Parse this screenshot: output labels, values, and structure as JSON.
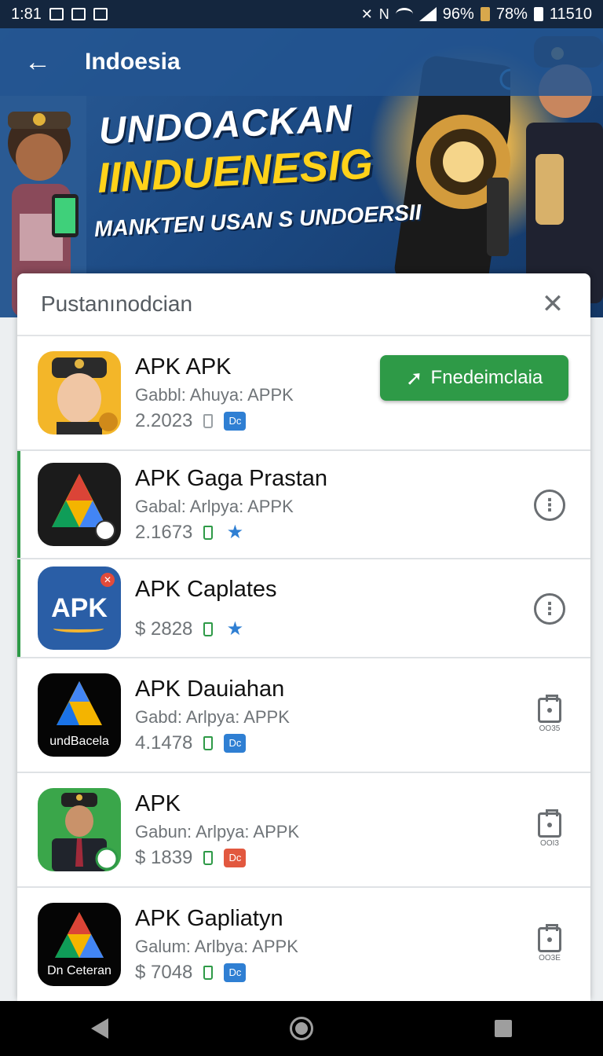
{
  "status_bar": {
    "time": "1:81",
    "signal_pct": "96%",
    "battery_pct": "78%",
    "right_value": "11510"
  },
  "app_bar": {
    "title": "Indoesia"
  },
  "hero": {
    "line1": "UNDOACKAN",
    "line2": "IINDUENESIG",
    "line3": "MANKTEN USAN S UNDOERSII"
  },
  "sheet": {
    "title": "Pustanınodcian",
    "close_glyph": "✕",
    "rows": [
      {
        "title": "APK APK",
        "subtitle": "Gabbl: Ahuya: APPK",
        "meta": "2.2023",
        "action": "Fnedeimclaia"
      },
      {
        "title": "APK Gaga Prastan",
        "subtitle": "Gabal: Arlpya: APPK",
        "meta": "2.1673"
      },
      {
        "title": "APK Caplates",
        "subtitle": "",
        "meta": "$ 2828",
        "icon_text": "APK"
      },
      {
        "title": "APK Dauiahan",
        "subtitle": "Gabd: Arlpya: APPK",
        "meta": "4.1478",
        "icon_caption": "undBacela",
        "clip_label": "OO35"
      },
      {
        "title": "APK",
        "subtitle": "Gabun: Arlpya: APPK",
        "meta": "$ 1839",
        "clip_label": "OOI3"
      },
      {
        "title": "APK Gapliatyn",
        "subtitle": "Galum: Arlbya: APPK",
        "meta": "$ 7048",
        "icon_caption": "Dn Ceteran",
        "clip_label": "OO3E"
      }
    ],
    "badge_text": "Dc"
  },
  "colors": {
    "accent_green": "#2e9a47",
    "badge_blue": "#2f7fd3",
    "headline_yellow": "#ffd21a"
  }
}
